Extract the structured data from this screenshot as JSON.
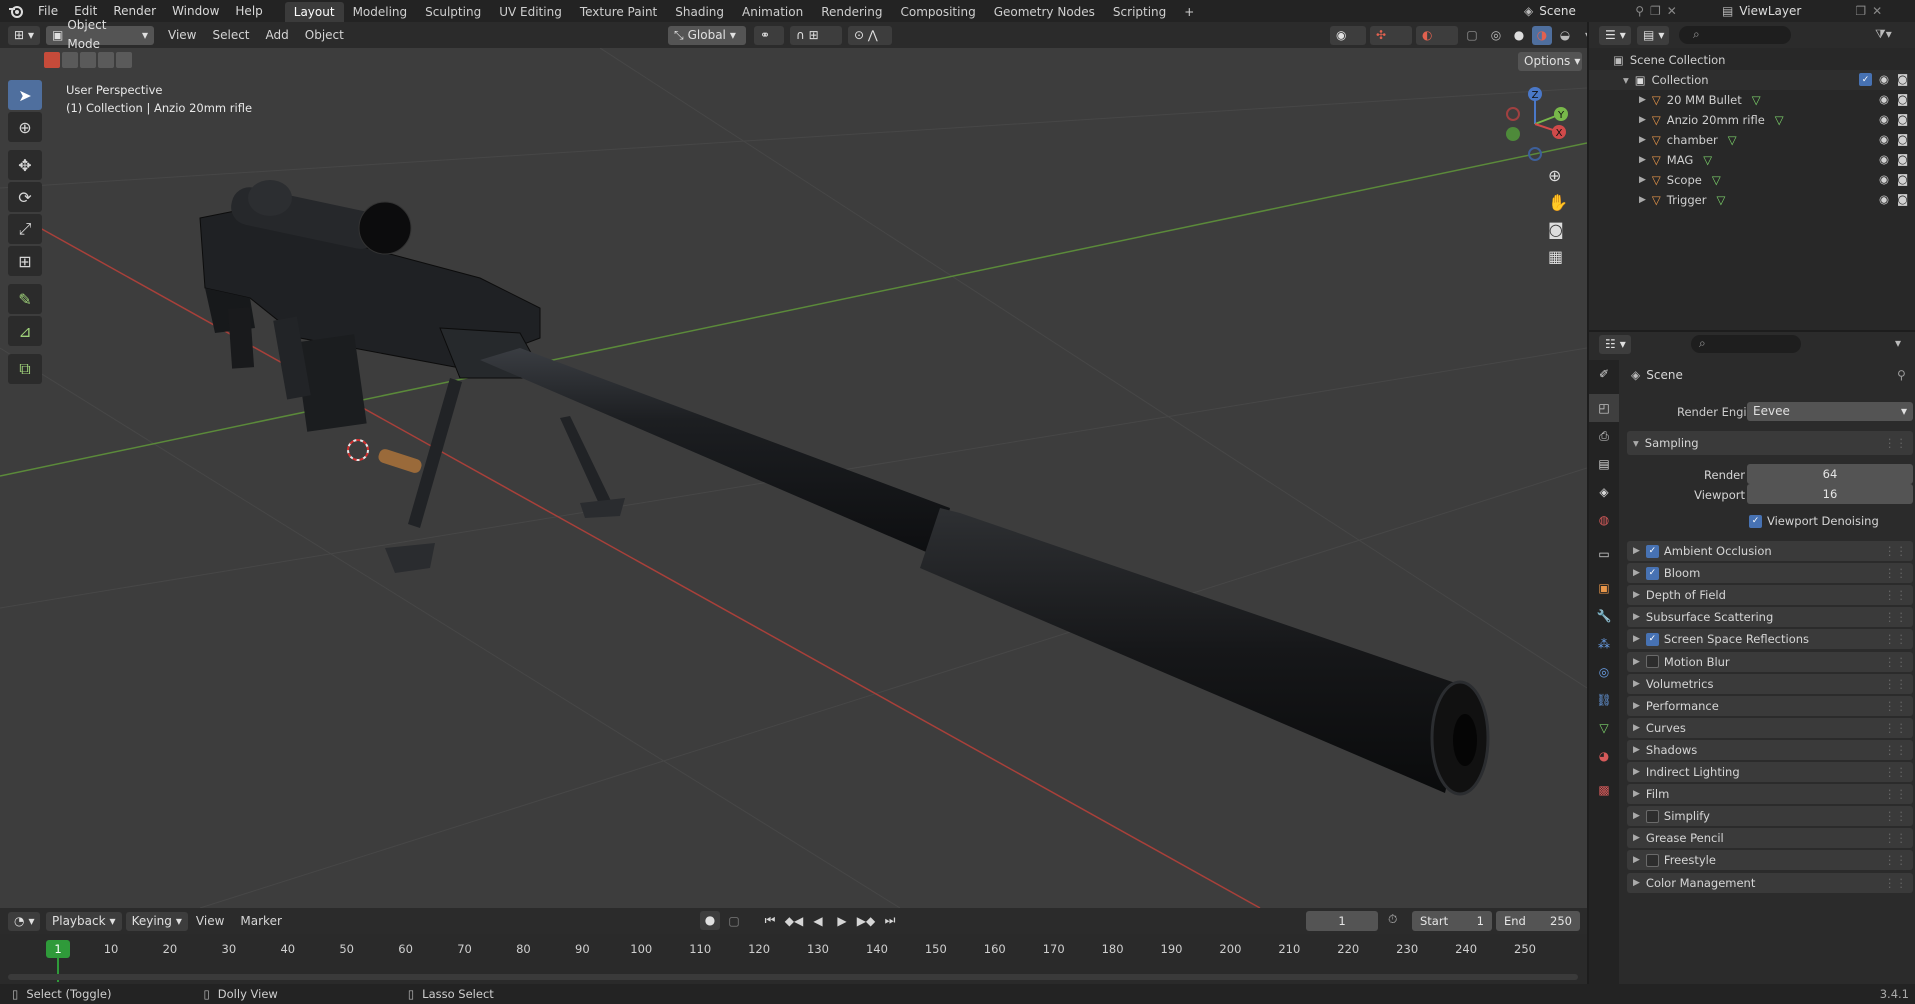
{
  "topbar": {
    "menus": [
      "File",
      "Edit",
      "Render",
      "Window",
      "Help"
    ],
    "workspaces": [
      "Layout",
      "Modeling",
      "Sculpting",
      "UV Editing",
      "Texture Paint",
      "Shading",
      "Animation",
      "Rendering",
      "Compositing",
      "Geometry Nodes",
      "Scripting"
    ],
    "active_workspace": "Layout",
    "add_tab": "+",
    "scene_name": "Scene",
    "view_layer": "ViewLayer"
  },
  "viewport_header": {
    "mode": "Object Mode",
    "menus": [
      "View",
      "Select",
      "Add",
      "Object"
    ],
    "orientation": "Global",
    "options": "Options"
  },
  "viewport": {
    "perspective": "User Perspective",
    "collection_info": "(1) Collection | Anzio 20mm rifle",
    "gizmo_axes": [
      "X",
      "Y",
      "Z"
    ]
  },
  "outliner": {
    "search_placeholder": "",
    "root": "Scene Collection",
    "collection": "Collection",
    "items": [
      {
        "name": "20 MM Bullet"
      },
      {
        "name": "Anzio 20mm rifle"
      },
      {
        "name": "chamber"
      },
      {
        "name": "MAG"
      },
      {
        "name": "Scope"
      },
      {
        "name": "Trigger"
      }
    ]
  },
  "properties": {
    "context": "Scene",
    "render_engine_label": "Render Engine",
    "render_engine": "Eevee",
    "sampling": {
      "title": "Sampling",
      "render_label": "Render",
      "render_value": "64",
      "viewport_label": "Viewport",
      "viewport_value": "16",
      "denoise_label": "Viewport Denoising",
      "denoise_on": true
    },
    "panels": [
      {
        "label": "Ambient Occlusion",
        "checkbox": true,
        "checked": true
      },
      {
        "label": "Bloom",
        "checkbox": true,
        "checked": true
      },
      {
        "label": "Depth of Field",
        "checkbox": false,
        "checked": false
      },
      {
        "label": "Subsurface Scattering",
        "checkbox": false,
        "checked": false
      },
      {
        "label": "Screen Space Reflections",
        "checkbox": true,
        "checked": true
      },
      {
        "label": "Motion Blur",
        "checkbox": true,
        "checked": false
      },
      {
        "label": "Volumetrics",
        "checkbox": false,
        "checked": false
      },
      {
        "label": "Performance",
        "checkbox": false,
        "checked": false
      },
      {
        "label": "Curves",
        "checkbox": false,
        "checked": false
      },
      {
        "label": "Shadows",
        "checkbox": false,
        "checked": false
      },
      {
        "label": "Indirect Lighting",
        "checkbox": false,
        "checked": false
      },
      {
        "label": "Film",
        "checkbox": false,
        "checked": false
      },
      {
        "label": "Simplify",
        "checkbox": true,
        "checked": false
      },
      {
        "label": "Grease Pencil",
        "checkbox": false,
        "checked": false
      },
      {
        "label": "Freestyle",
        "checkbox": true,
        "checked": false
      },
      {
        "label": "Color Management",
        "checkbox": false,
        "checked": false
      }
    ]
  },
  "timeline": {
    "menus": [
      "Playback",
      "Keying",
      "View",
      "Marker"
    ],
    "current_frame": "1",
    "start_label": "Start",
    "start": "1",
    "end_label": "End",
    "end": "250",
    "ruler": [
      "1",
      "10",
      "20",
      "30",
      "40",
      "50",
      "60",
      "70",
      "80",
      "90",
      "100",
      "110",
      "120",
      "130",
      "140",
      "150",
      "160",
      "170",
      "180",
      "190",
      "200",
      "210",
      "220",
      "230",
      "240",
      "250"
    ]
  },
  "statusbar": {
    "select": "Select (Toggle)",
    "dolly": "Dolly View",
    "lasso": "Lasso Select",
    "version": "3.4.1"
  },
  "colors": {
    "accent": "#4772b3",
    "active_frame": "#2f9a3a",
    "object_orange": "#e8964a",
    "mesh_green": "#7dd36b"
  }
}
